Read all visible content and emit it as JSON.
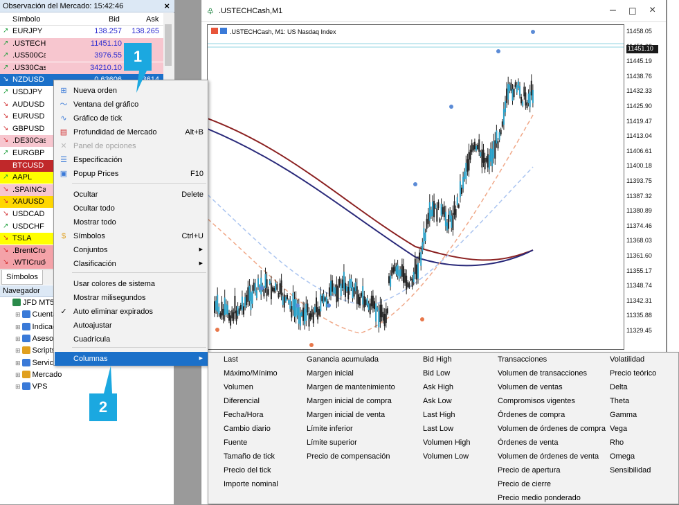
{
  "market_watch": {
    "title": "Observación del Mercado: 15:42:46",
    "col_symbol": "Símbolo",
    "col_bid": "Bid",
    "col_ask": "Ask",
    "tab": "Símbolos",
    "rows": [
      {
        "arrow": "↗",
        "symbol": "EURJPY",
        "bid": "138.257",
        "ask": "138.265",
        "bg": "#ffffff",
        "dir": "up"
      },
      {
        "arrow": "↗",
        "symbol": ".USTECHCash",
        "bid": "11451.10",
        "ask": "",
        "bg": "#f7c6cf",
        "dir": "up"
      },
      {
        "arrow": "↗",
        "symbol": ".US500Cash",
        "bid": "3976.55",
        "ask": "",
        "bg": "#f7c6cf",
        "dir": "up"
      },
      {
        "arrow": "↗",
        "symbol": ".US30Cash",
        "bid": "34210.10",
        "ask": "",
        "bg": "#f7c6cf",
        "dir": "up"
      },
      {
        "arrow": "↘",
        "symbol": "NZDUSD",
        "bid": "0.63606",
        "ask": "63614",
        "bg": "#1b70c9",
        "dir": "down"
      },
      {
        "arrow": "↗",
        "symbol": "USDJPY",
        "bid": "",
        "ask": "",
        "bg": "#ffffff",
        "dir": "up"
      },
      {
        "arrow": "↘",
        "symbol": "AUDUSD",
        "bid": "",
        "ask": "",
        "bg": "#ffffff",
        "dir": "down"
      },
      {
        "arrow": "↘",
        "symbol": "EURUSD",
        "bid": "",
        "ask": "",
        "bg": "#ffffff",
        "dir": "down"
      },
      {
        "arrow": "↘",
        "symbol": "GBPUSD",
        "bid": "",
        "ask": "",
        "bg": "#ffffff",
        "dir": "down"
      },
      {
        "arrow": "↘",
        "symbol": ".DE30Cash",
        "bid": "",
        "ask": "",
        "bg": "#f7c6cf",
        "dir": "down"
      },
      {
        "arrow": "↗",
        "symbol": "EURGBP",
        "bid": "",
        "ask": "",
        "bg": "#ffffff",
        "dir": "up"
      },
      {
        "arrow": "",
        "symbol": "BTCUSD",
        "bid": "",
        "ask": "",
        "bg": "#c0282a",
        "dir": "none"
      },
      {
        "arrow": "↗",
        "symbol": "AAPL",
        "bid": "",
        "ask": "",
        "bg": "#ffff00",
        "dir": "up"
      },
      {
        "arrow": "↘",
        "symbol": ".SPAINCash",
        "bid": "",
        "ask": "",
        "bg": "#f7c6cf",
        "dir": "down"
      },
      {
        "arrow": "↘",
        "symbol": "XAUUSD",
        "bid": "",
        "ask": "",
        "bg": "#ffd700",
        "dir": "down"
      },
      {
        "arrow": "↘",
        "symbol": "USDCAD",
        "bid": "",
        "ask": "",
        "bg": "#ffffff",
        "dir": "down"
      },
      {
        "arrow": "↗",
        "symbol": "USDCHF",
        "bid": "",
        "ask": "",
        "bg": "#ffffff",
        "dir": "up"
      },
      {
        "arrow": "↘",
        "symbol": "TSLA",
        "bid": "",
        "ask": "",
        "bg": "#ffff00",
        "dir": "down"
      },
      {
        "arrow": "↘",
        "symbol": ".BrentCrude",
        "bid": "",
        "ask": "",
        "bg": "#f4a2a8",
        "dir": "down"
      },
      {
        "arrow": "↘",
        "symbol": ".WTICrude",
        "bid": "",
        "ask": "",
        "bg": "#f4a2a8",
        "dir": "down"
      }
    ]
  },
  "navigator": {
    "title": "Navegador",
    "items": [
      {
        "label": "JFD MT5",
        "indent": 0,
        "icon": "broker-icon"
      },
      {
        "label": "Cuentas",
        "indent": 1,
        "icon": "accounts-icon"
      },
      {
        "label": "Indicadores",
        "indent": 1,
        "icon": "indicators-icon"
      },
      {
        "label": "Asesores",
        "indent": 1,
        "icon": "advisors-icon"
      },
      {
        "label": "Scripts",
        "indent": 1,
        "icon": "scripts-icon"
      },
      {
        "label": "Servicios",
        "indent": 1,
        "icon": "services-icon"
      },
      {
        "label": "Mercado",
        "indent": 1,
        "icon": "market-icon"
      },
      {
        "label": "VPS",
        "indent": 1,
        "icon": "vps-icon"
      }
    ]
  },
  "chart_window": {
    "title": ".USTECHCash,M1",
    "info": ".USTECHCash, M1:  US Nasdaq Index",
    "current_price": "11451.10",
    "price_ticks": [
      "11458.05",
      "11451.62",
      "11445.19",
      "11438.76",
      "11432.33",
      "11425.90",
      "11419.47",
      "11413.04",
      "11406.61",
      "11400.18",
      "11393.75",
      "11387.32",
      "11380.89",
      "11374.46",
      "11368.03",
      "11361.60",
      "11355.17",
      "11348.74",
      "11342.31",
      "11335.88",
      "11329.45"
    ]
  },
  "context_menu": {
    "items": [
      {
        "label": "Nueva orden",
        "shortcut": "",
        "icon": "new-order-icon",
        "disabled": false
      },
      {
        "label": "Ventana del gráfico",
        "shortcut": "",
        "icon": "chart-window-icon",
        "disabled": false
      },
      {
        "label": "Gráfico de tick",
        "shortcut": "",
        "icon": "tick-chart-icon",
        "disabled": false
      },
      {
        "label": "Profundidad de Mercado",
        "shortcut": "Alt+B",
        "icon": "depth-icon",
        "disabled": false
      },
      {
        "label": "Panel de opciones",
        "shortcut": "",
        "icon": "options-icon",
        "disabled": true
      },
      {
        "label": "Especificación",
        "shortcut": "",
        "icon": "spec-icon",
        "disabled": false
      },
      {
        "label": "Popup Prices",
        "shortcut": "F10",
        "icon": "popup-icon",
        "disabled": false
      },
      {
        "label": "Ocultar",
        "shortcut": "Delete",
        "icon": "",
        "disabled": false
      },
      {
        "label": "Ocultar todo",
        "shortcut": "",
        "icon": "",
        "disabled": false
      },
      {
        "label": "Mostrar todo",
        "shortcut": "",
        "icon": "",
        "disabled": false
      },
      {
        "label": "Símbolos",
        "shortcut": "Ctrl+U",
        "icon": "symbols-icon",
        "disabled": false
      },
      {
        "label": "Conjuntos",
        "shortcut": "",
        "icon": "",
        "disabled": false
      },
      {
        "label": "Clasificación",
        "shortcut": "",
        "icon": "",
        "disabled": false
      },
      {
        "label": "Usar colores de sistema",
        "shortcut": "",
        "icon": "",
        "disabled": false
      },
      {
        "label": "Mostrar milisegundos",
        "shortcut": "",
        "icon": "",
        "disabled": false
      },
      {
        "label": "Auto eliminar expirados",
        "shortcut": "",
        "icon": "check-icon",
        "disabled": false
      },
      {
        "label": "Autoajustar",
        "shortcut": "",
        "icon": "",
        "disabled": false
      },
      {
        "label": "Cuadrícula",
        "shortcut": "",
        "icon": "",
        "disabled": false
      },
      {
        "label": "Columnas",
        "shortcut": "",
        "icon": "",
        "disabled": false
      }
    ]
  },
  "columns_submenu": [
    [
      "Last",
      "Máximo/Mínimo",
      "Volumen",
      "Diferencial",
      "Fecha/Hora",
      "Cambio diario",
      "Fuente",
      "Tamaño de tick",
      "Precio del tick",
      "Importe nominal"
    ],
    [
      "Ganancia acumulada",
      "Margen inicial",
      "Margen de mantenimiento",
      "Margen inicial de compra",
      "Margen inicial de venta",
      "Límite inferior",
      "Límite superior",
      "Precio de compensación"
    ],
    [
      "Bid High",
      "Bid Low",
      "Ask High",
      "Ask Low",
      "Last High",
      "Last Low",
      "Volumen High",
      "Volumen Low"
    ],
    [
      "Transacciones",
      "Volumen de transacciones",
      "Volumen de ventas",
      "Compromisos vigentes",
      "Órdenes de compra",
      "Volumen de órdenes de compra",
      "Órdenes de venta",
      "Volumen de órdenes de venta",
      "Precio de apertura",
      "Precio de cierre",
      "Precio medio ponderado"
    ],
    [
      "Volatilidad",
      "Precio teórico",
      "Delta",
      "Theta",
      "Gamma",
      "Vega",
      "Rho",
      "Omega",
      "Sensibilidad"
    ]
  ],
  "callouts": [
    "1",
    "2"
  ],
  "colors": {
    "accent": "#1b70c9",
    "callout": "#1ba8e0",
    "up": "#1b9e3a",
    "down": "#d0282a"
  }
}
